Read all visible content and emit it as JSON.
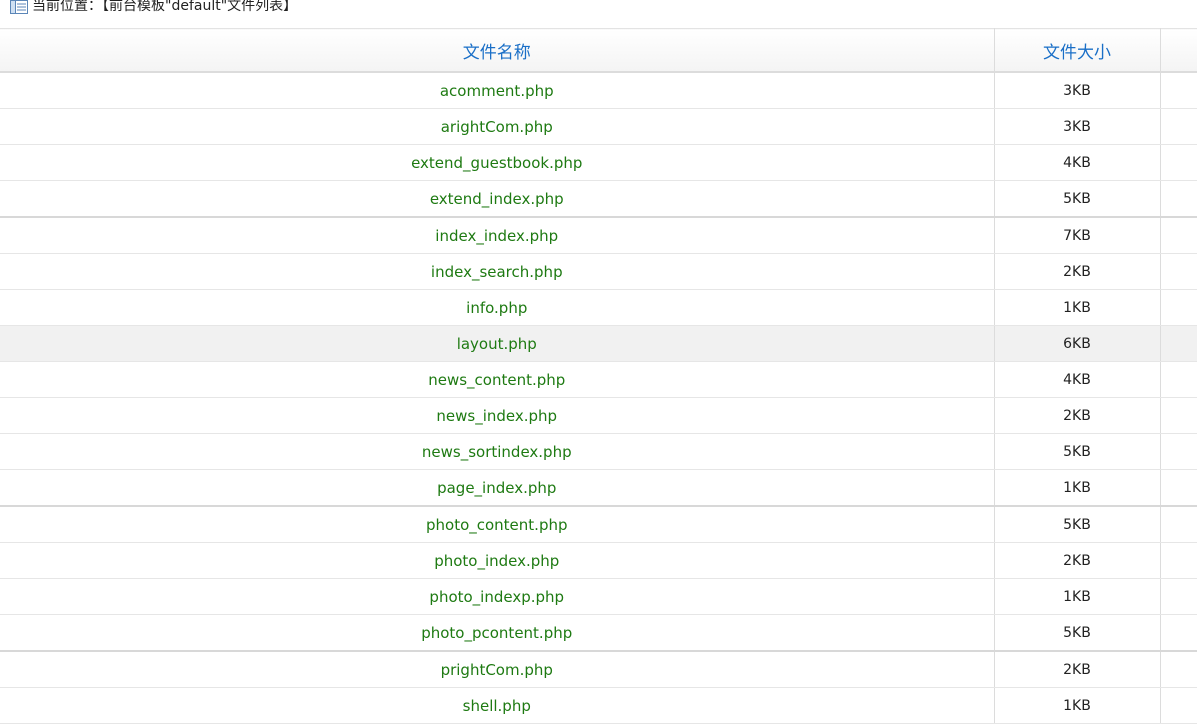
{
  "breadcrumb": {
    "icon": "list-icon",
    "text": "当前位置：【前台模板\"default\"文件列表】"
  },
  "table": {
    "columns": [
      "文件名称",
      "文件大小"
    ],
    "rows": [
      {
        "name": "acomment.php",
        "size": "3KB"
      },
      {
        "name": "arightCom.php",
        "size": "3KB"
      },
      {
        "name": "extend_guestbook.php",
        "size": "4KB"
      },
      {
        "name": "extend_index.php",
        "size": "5KB"
      },
      {
        "name": "index_index.php",
        "size": "7KB"
      },
      {
        "name": "index_search.php",
        "size": "2KB"
      },
      {
        "name": "info.php",
        "size": "1KB"
      },
      {
        "name": "layout.php",
        "size": "6KB"
      },
      {
        "name": "news_content.php",
        "size": "4KB"
      },
      {
        "name": "news_index.php",
        "size": "2KB"
      },
      {
        "name": "news_sortindex.php",
        "size": "5KB"
      },
      {
        "name": "page_index.php",
        "size": "1KB"
      },
      {
        "name": "photo_content.php",
        "size": "5KB"
      },
      {
        "name": "photo_index.php",
        "size": "2KB"
      },
      {
        "name": "photo_indexp.php",
        "size": "1KB"
      },
      {
        "name": "photo_pcontent.php",
        "size": "5KB"
      },
      {
        "name": "prightCom.php",
        "size": "2KB"
      },
      {
        "name": "shell.php",
        "size": "1KB"
      }
    ]
  },
  "colors": {
    "header_text": "#1a6fc7",
    "link_text": "#1e7a12",
    "highlight_row": "#f1f1f1"
  }
}
